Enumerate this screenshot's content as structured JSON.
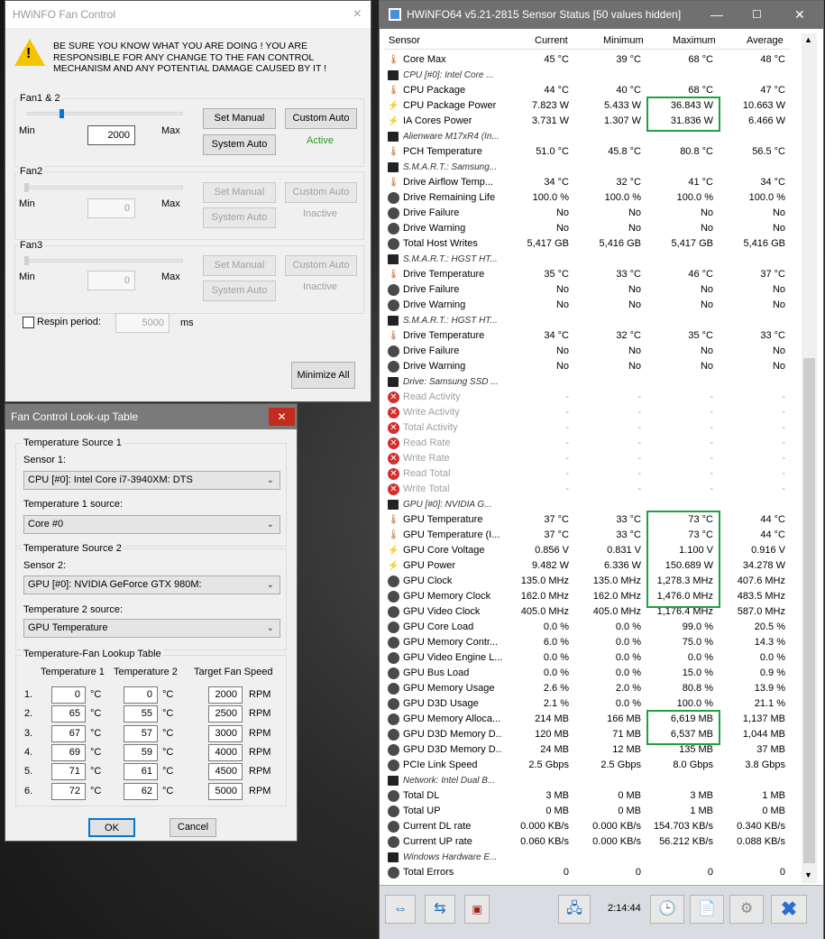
{
  "fan_window": {
    "title": "HWiNFO Fan Control",
    "warning": "BE SURE YOU KNOW WHAT YOU ARE DOING ! YOU ARE RESPONSIBLE FOR ANY CHANGE TO THE FAN CONTROL MECHANISM AND ANY POTENTIAL DAMAGE CAUSED BY IT !",
    "min_label": "Min",
    "max_label": "Max",
    "set_manual": "Set Manual",
    "custom_auto": "Custom Auto",
    "system_auto": "System Auto",
    "fans": [
      {
        "name": "Fan1 & 2",
        "value": "2000",
        "status": "Active",
        "level": 0.22
      },
      {
        "name": "Fan2",
        "value": "0",
        "status": "Inactive",
        "level": 0
      },
      {
        "name": "Fan3",
        "value": "0",
        "status": "Inactive",
        "level": 0
      }
    ],
    "respin_label": "Respin period:",
    "respin_value": "5000",
    "respin_unit": "ms",
    "minimize_all": "Minimize All",
    "close_icon": "×"
  },
  "lookup_window": {
    "title": "Fan Control Look-up Table",
    "close": "✕",
    "source1_group": "Temperature Source 1",
    "sensor1_label": "Sensor 1:",
    "sensor1_value": "CPU [#0]: Intel Core i7-3940XM: DTS",
    "temp1_label": "Temperature 1 source:",
    "temp1_value": "Core #0",
    "source2_group": "Temperature Source 2",
    "sensor2_label": "Sensor 2:",
    "sensor2_value": "GPU [#0]: NVIDIA GeForce GTX 980M:",
    "temp2_label": "Temperature 2 source:",
    "temp2_value": "GPU Temperature",
    "table_group": "Temperature-Fan Lookup Table",
    "col_t1": "Temperature 1",
    "col_t2": "Temperature 2",
    "col_speed": "Target Fan Speed",
    "unit_c": "°C",
    "unit_rpm": "RPM",
    "rows": [
      [
        "1.",
        "0",
        "0",
        "2000"
      ],
      [
        "2.",
        "65",
        "55",
        "2500"
      ],
      [
        "3.",
        "67",
        "57",
        "3000"
      ],
      [
        "4.",
        "69",
        "59",
        "4000"
      ],
      [
        "5.",
        "71",
        "61",
        "4500"
      ],
      [
        "6.",
        "72",
        "62",
        "5000"
      ]
    ],
    "ok": "OK",
    "cancel": "Cancel"
  },
  "sensor_window": {
    "title": "HWiNFO64 v5.21-2815 Sensor Status [50 values hidden]",
    "time": "2:14:44",
    "columns": [
      "Sensor",
      "Current",
      "Minimum",
      "Maximum",
      "Average"
    ],
    "rows": [
      [
        "Core Max",
        "45 °C",
        "39 °C",
        "68 °C",
        "48 °C",
        "t",
        ""
      ],
      [
        "CPU [#0]: Intel Core ...",
        "",
        "",
        "",
        "",
        "h",
        ""
      ],
      [
        "CPU Package",
        "44 °C",
        "40 °C",
        "68 °C",
        "47 °C",
        "t",
        ""
      ],
      [
        "CPU Package Power",
        "7.823 W",
        "5.433 W",
        "36.843 W",
        "10.663 W",
        "p",
        ""
      ],
      [
        "IA Cores Power",
        "3.731 W",
        "1.307 W",
        "31.836 W",
        "6.466 W",
        "p",
        ""
      ],
      [
        "Alienware M17xR4 (In...",
        "",
        "",
        "",
        "",
        "h",
        ""
      ],
      [
        "PCH Temperature",
        "51.0 °C",
        "45.8 °C",
        "80.8 °C",
        "56.5 °C",
        "t",
        ""
      ],
      [
        "S.M.A.R.T.: Samsung...",
        "",
        "",
        "",
        "",
        "h",
        ""
      ],
      [
        "Drive Airflow Temp...",
        "34 °C",
        "32 °C",
        "41 °C",
        "34 °C",
        "t",
        ""
      ],
      [
        "Drive Remaining Life",
        "100.0 %",
        "100.0 %",
        "100.0 %",
        "100.0 %",
        "g",
        ""
      ],
      [
        "Drive Failure",
        "No",
        "No",
        "No",
        "No",
        "g",
        ""
      ],
      [
        "Drive Warning",
        "No",
        "No",
        "No",
        "No",
        "g",
        ""
      ],
      [
        "Total Host Writes",
        "5,417 GB",
        "5,416 GB",
        "5,417 GB",
        "5,416 GB",
        "g",
        ""
      ],
      [
        "S.M.A.R.T.: HGST HT...",
        "",
        "",
        "",
        "",
        "h",
        ""
      ],
      [
        "Drive Temperature",
        "35 °C",
        "33 °C",
        "46 °C",
        "37 °C",
        "t",
        ""
      ],
      [
        "Drive Failure",
        "No",
        "No",
        "No",
        "No",
        "g",
        ""
      ],
      [
        "Drive Warning",
        "No",
        "No",
        "No",
        "No",
        "g",
        ""
      ],
      [
        "S.M.A.R.T.: HGST HT...",
        "",
        "",
        "",
        "",
        "h",
        ""
      ],
      [
        "Drive Temperature",
        "34 °C",
        "32 °C",
        "35 °C",
        "33 °C",
        "t",
        ""
      ],
      [
        "Drive Failure",
        "No",
        "No",
        "No",
        "No",
        "g",
        ""
      ],
      [
        "Drive Warning",
        "No",
        "No",
        "No",
        "No",
        "g",
        ""
      ],
      [
        "Drive: Samsung SSD ...",
        "",
        "",
        "",
        "",
        "h",
        ""
      ],
      [
        "Read Activity",
        "-",
        "-",
        "-",
        "-",
        "x",
        "d"
      ],
      [
        "Write Activity",
        "-",
        "-",
        "-",
        "-",
        "x",
        "d"
      ],
      [
        "Total Activity",
        "-",
        "-",
        "-",
        "-",
        "x",
        "d"
      ],
      [
        "Read Rate",
        "-",
        "-",
        "-",
        "-",
        "x",
        "d"
      ],
      [
        "Write Rate",
        "-",
        "-",
        "-",
        "-",
        "x",
        "d"
      ],
      [
        "Read Total",
        "-",
        "-",
        "-",
        "-",
        "x",
        "d"
      ],
      [
        "Write Total",
        "-",
        "-",
        "-",
        "-",
        "x",
        "d"
      ],
      [
        "GPU [#0]: NVIDIA G...",
        "",
        "",
        "",
        "",
        "h",
        ""
      ],
      [
        "GPU Temperature",
        "37 °C",
        "33 °C",
        "73 °C",
        "44 °C",
        "t",
        ""
      ],
      [
        "GPU Temperature (I...",
        "37 °C",
        "33 °C",
        "73 °C",
        "44 °C",
        "t",
        ""
      ],
      [
        "GPU Core Voltage",
        "0.856 V",
        "0.831 V",
        "1.100 V",
        "0.916 V",
        "p",
        ""
      ],
      [
        "GPU Power",
        "9.482 W",
        "6.336 W",
        "150.689 W",
        "34.278 W",
        "p",
        ""
      ],
      [
        "GPU Clock",
        "135.0 MHz",
        "135.0 MHz",
        "1,278.3 MHz",
        "407.6 MHz",
        "g",
        ""
      ],
      [
        "GPU Memory Clock",
        "162.0 MHz",
        "162.0 MHz",
        "1,476.0 MHz",
        "483.5 MHz",
        "g",
        ""
      ],
      [
        "GPU Video Clock",
        "405.0 MHz",
        "405.0 MHz",
        "1,176.4 MHz",
        "587.0 MHz",
        "g",
        ""
      ],
      [
        "GPU Core Load",
        "0.0 %",
        "0.0 %",
        "99.0 %",
        "20.5 %",
        "g",
        ""
      ],
      [
        "GPU Memory Contr...",
        "6.0 %",
        "0.0 %",
        "75.0 %",
        "14.3 %",
        "g",
        ""
      ],
      [
        "GPU Video Engine L...",
        "0.0 %",
        "0.0 %",
        "0.0 %",
        "0.0 %",
        "g",
        ""
      ],
      [
        "GPU Bus Load",
        "0.0 %",
        "0.0 %",
        "15.0 %",
        "0.9 %",
        "g",
        ""
      ],
      [
        "GPU Memory Usage",
        "2.6 %",
        "2.0 %",
        "80.8 %",
        "13.9 %",
        "g",
        ""
      ],
      [
        "GPU D3D Usage",
        "2.1 %",
        "0.0 %",
        "100.0 %",
        "21.1 %",
        "g",
        ""
      ],
      [
        "GPU Memory Alloca...",
        "214 MB",
        "166 MB",
        "6,619 MB",
        "1,137 MB",
        "g",
        ""
      ],
      [
        "GPU D3D Memory D...",
        "120 MB",
        "71 MB",
        "6,537 MB",
        "1,044 MB",
        "g",
        ""
      ],
      [
        "GPU D3D Memory D...",
        "24 MB",
        "12 MB",
        "135 MB",
        "37 MB",
        "g",
        ""
      ],
      [
        "PCIe Link Speed",
        "2.5 Gbps",
        "2.5 Gbps",
        "8.0 Gbps",
        "3.8 Gbps",
        "g",
        ""
      ],
      [
        "Network: Intel Dual B...",
        "",
        "",
        "",
        "",
        "h",
        ""
      ],
      [
        "Total DL",
        "3 MB",
        "0 MB",
        "3 MB",
        "1 MB",
        "g",
        ""
      ],
      [
        "Total UP",
        "0 MB",
        "0 MB",
        "1 MB",
        "0 MB",
        "g",
        ""
      ],
      [
        "Current DL rate",
        "0.000 KB/s",
        "0.000 KB/s",
        "154.703 KB/s",
        "0.340 KB/s",
        "g",
        ""
      ],
      [
        "Current UP rate",
        "0.060 KB/s",
        "0.000 KB/s",
        "56.212 KB/s",
        "0.088 KB/s",
        "g",
        ""
      ],
      [
        "Windows Hardware E...",
        "",
        "",
        "",
        "",
        "h",
        ""
      ],
      [
        "Total Errors",
        "0",
        "0",
        "0",
        "0",
        "g",
        ""
      ]
    ]
  }
}
